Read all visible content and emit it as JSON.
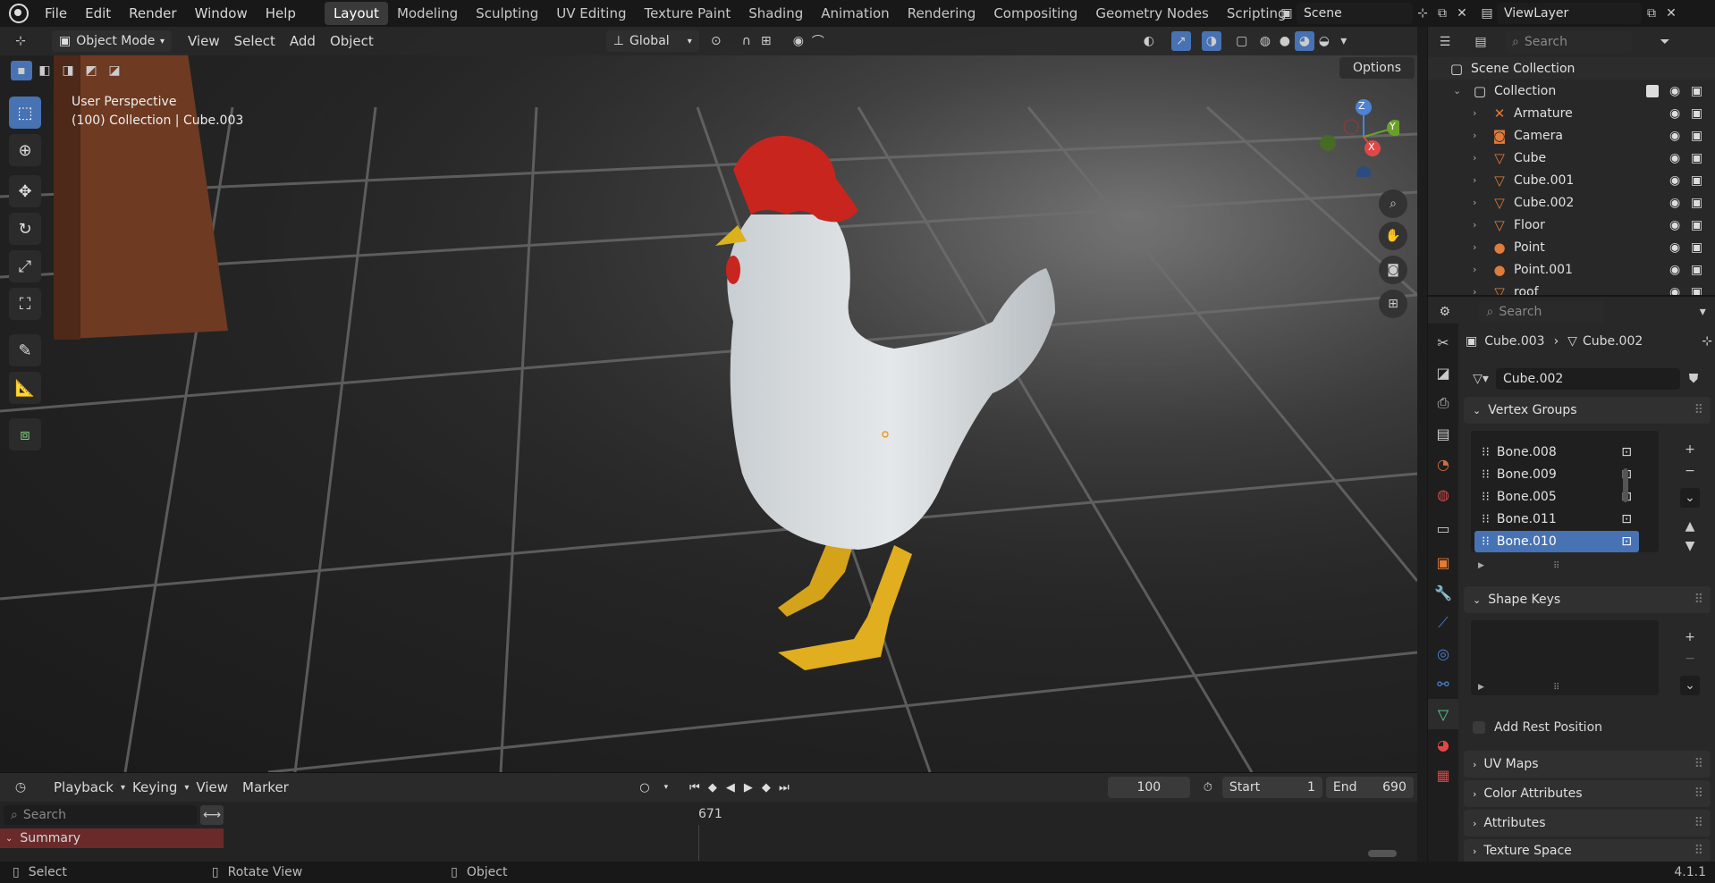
{
  "topbar": {
    "menus": [
      "File",
      "Edit",
      "Render",
      "Window",
      "Help"
    ],
    "workspaces": [
      "Layout",
      "Modeling",
      "Sculpting",
      "UV Editing",
      "Texture Paint",
      "Shading",
      "Animation",
      "Rendering",
      "Compositing",
      "Geometry Nodes",
      "Scripting"
    ],
    "active_workspace": "Layout",
    "add": "+",
    "scene": "Scene",
    "view_layer": "ViewLayer"
  },
  "viewport": {
    "mode": "Object Mode",
    "menus": [
      "View",
      "Select",
      "Add",
      "Object"
    ],
    "orientation": "Global",
    "options": "Options",
    "perspective": "User Perspective",
    "collection_info": "(100) Collection | Cube.003",
    "gizmo": {
      "z": "Z",
      "y": "Y",
      "x": "X"
    }
  },
  "outliner": {
    "search_placeholder": "Search",
    "scene_collection": "Scene Collection",
    "collection": "Collection",
    "items": [
      {
        "name": "Armature",
        "color": "#e07b3a",
        "icon": "armature-icon"
      },
      {
        "name": "Camera",
        "color": "#e07b3a",
        "icon": "camera-icon"
      },
      {
        "name": "Cube",
        "color": "#e07b3a",
        "icon": "mesh-icon"
      },
      {
        "name": "Cube.001",
        "color": "#e07b3a",
        "icon": "mesh-icon"
      },
      {
        "name": "Cube.002",
        "color": "#e07b3a",
        "icon": "mesh-icon"
      },
      {
        "name": "Floor",
        "color": "#e07b3a",
        "icon": "mesh-icon"
      },
      {
        "name": "Point",
        "color": "#e07b3a",
        "icon": "light-icon"
      },
      {
        "name": "Point.001",
        "color": "#e07b3a",
        "icon": "light-icon"
      },
      {
        "name": "roof",
        "color": "#e07b3a",
        "icon": "mesh-icon"
      }
    ]
  },
  "properties": {
    "search_placeholder": "Search",
    "breadcrumb_object": "Cube.003",
    "breadcrumb_data": "Cube.002",
    "data_name": "Cube.002",
    "vertex_groups_title": "Vertex Groups",
    "vertex_groups": [
      "Bone.008",
      "Bone.009",
      "Bone.005",
      "Bone.011",
      "Bone.010"
    ],
    "selected_group": "Bone.010",
    "shape_keys_title": "Shape Keys",
    "add_rest_position": "Add Rest Position",
    "panels": [
      "UV Maps",
      "Color Attributes",
      "Attributes",
      "Texture Space"
    ]
  },
  "timeline": {
    "menus": [
      "Playback",
      "Keying",
      "View",
      "Marker"
    ],
    "current_frame": "100",
    "start_label": "Start",
    "start": "1",
    "end_label": "End",
    "end": "690",
    "search_placeholder": "Search",
    "playhead": "671",
    "summary": "Summary"
  },
  "statusbar": {
    "select": "Select",
    "rotate": "Rotate View",
    "object": "Object",
    "version": "4.1.1"
  }
}
